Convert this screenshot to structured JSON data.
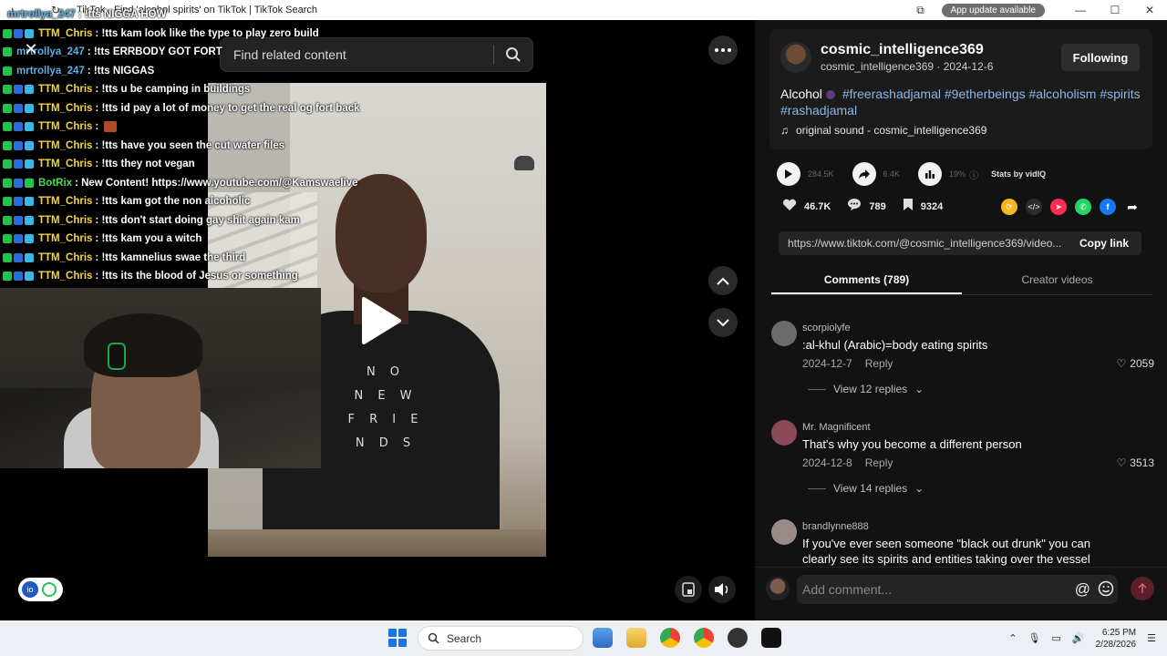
{
  "titlebar": {
    "title": "TikTok - Find 'alcohol spirits' on TikTok | TikTok Search",
    "update_label": "App update available"
  },
  "search": {
    "placeholder": "Find related content"
  },
  "chat": [
    {
      "user": "mrtrollya_247",
      "msg": ": !tts NIGGA HOW",
      "color": "#5fb0e0",
      "badges": []
    },
    {
      "user": "TTM_Chris",
      "msg": ": !tts kam look like the type to play zero build",
      "color": "#f5d63b",
      "badges": [
        "green",
        "blue",
        "cyan"
      ]
    },
    {
      "user": "mrtrollya_247",
      "msg": ": !tts ERRBODY GOT FORT",
      "color": "#5fb0e0",
      "badges": [
        "green"
      ]
    },
    {
      "user": "mrtrollya_247",
      "msg": ": !tts NIGGAS",
      "color": "#5fb0e0",
      "badges": [
        "green"
      ]
    },
    {
      "user": "TTM_Chris",
      "msg": ": !tts u be camping in buildings",
      "color": "#f5d63b",
      "badges": [
        "green",
        "blue",
        "cyan"
      ]
    },
    {
      "user": "TTM_Chris",
      "msg": ": !tts id pay a lot of money to get the real og fort back",
      "color": "#f5d63b",
      "badges": [
        "green",
        "blue",
        "cyan"
      ]
    },
    {
      "user": "TTM_Chris",
      "msg": ":",
      "color": "#f5d63b",
      "badges": [
        "green",
        "blue",
        "cyan"
      ],
      "emote": true
    },
    {
      "user": "TTM_Chris",
      "msg": ": !tts have you seen the cut water files",
      "color": "#f5d63b",
      "badges": [
        "green",
        "blue",
        "cyan"
      ]
    },
    {
      "user": "TTM_Chris",
      "msg": ": !tts they not vegan",
      "color": "#f5d63b",
      "badges": [
        "green",
        "blue",
        "cyan"
      ]
    },
    {
      "user": "BotRix",
      "msg": ": New Content! https://www.youtube.com/@Kamswaelive",
      "color": "#4ddc5a",
      "badges": [
        "green",
        "blue",
        "green"
      ]
    },
    {
      "user": "TTM_Chris",
      "msg": ": !tts kam got the non alcoholic",
      "color": "#f5d63b",
      "badges": [
        "green",
        "blue",
        "cyan"
      ]
    },
    {
      "user": "TTM_Chris",
      "msg": ": !tts don't start doing gay shit again kam",
      "color": "#f5d63b",
      "badges": [
        "green",
        "blue",
        "cyan"
      ]
    },
    {
      "user": "TTM_Chris",
      "msg": ": !tts kam you a witch",
      "color": "#f5d63b",
      "badges": [
        "green",
        "blue",
        "cyan"
      ]
    },
    {
      "user": "TTM_Chris",
      "msg": ": !tts kamnelius swae the third",
      "color": "#f5d63b",
      "badges": [
        "green",
        "blue",
        "cyan"
      ]
    },
    {
      "user": "TTM_Chris",
      "msg": ": !tts its the blood of Jesus or something",
      "color": "#f5d63b",
      "badges": [
        "green",
        "blue",
        "cyan"
      ]
    }
  ],
  "video": {
    "shirt_text": "N O\nN E W\nF R I E N D S"
  },
  "author": {
    "name": "cosmic_intelligence369",
    "sub": "cosmic_intelligence369 · 2024-12-6",
    "follow_label": "Following"
  },
  "caption": {
    "text": "Alcohol",
    "tags": "#freerashadjamal #9etherbeings #alcoholism #spirits #rashadjamal",
    "sound": "original sound - cosmic_intelligence369"
  },
  "stats": {
    "plays": "284.5K",
    "shares": "6.4K",
    "pct": "19%",
    "stats_by": "Stats by vidIQ"
  },
  "actions": {
    "likes": "46.7K",
    "comments": "789",
    "saves": "9324"
  },
  "link": {
    "url": "https://www.tiktok.com/@cosmic_intelligence369/video...",
    "copy_label": "Copy link"
  },
  "tabs": {
    "comments": "Comments (789)",
    "creator": "Creator videos"
  },
  "comments": [
    {
      "user": "scorpiolyfe",
      "text": ":al-khul (Arabic)=body eating spirits",
      "date": "2024-12-7",
      "reply": "Reply",
      "likes": "2059",
      "replies": "View 12 replies",
      "avatar": "#6b6b6b"
    },
    {
      "user": "Mr. Magnificent",
      "text": "That's why you become a different person",
      "date": "2024-12-8",
      "reply": "Reply",
      "likes": "3513",
      "replies": "View 14 replies",
      "avatar": "#8a4a5a"
    },
    {
      "user": "brandlynne888",
      "text": "If you've ever seen someone \"black out drunk\" you can clearly see its spirits and entities taking over the vessel",
      "date": "",
      "reply": "",
      "likes": "",
      "replies": "",
      "avatar": "#9a8a8a"
    }
  ],
  "comment_bar": {
    "placeholder": "Add comment..."
  },
  "taskbar": {
    "search_label": "Search",
    "time": "6:25 PM",
    "date": "2/28/2026"
  }
}
